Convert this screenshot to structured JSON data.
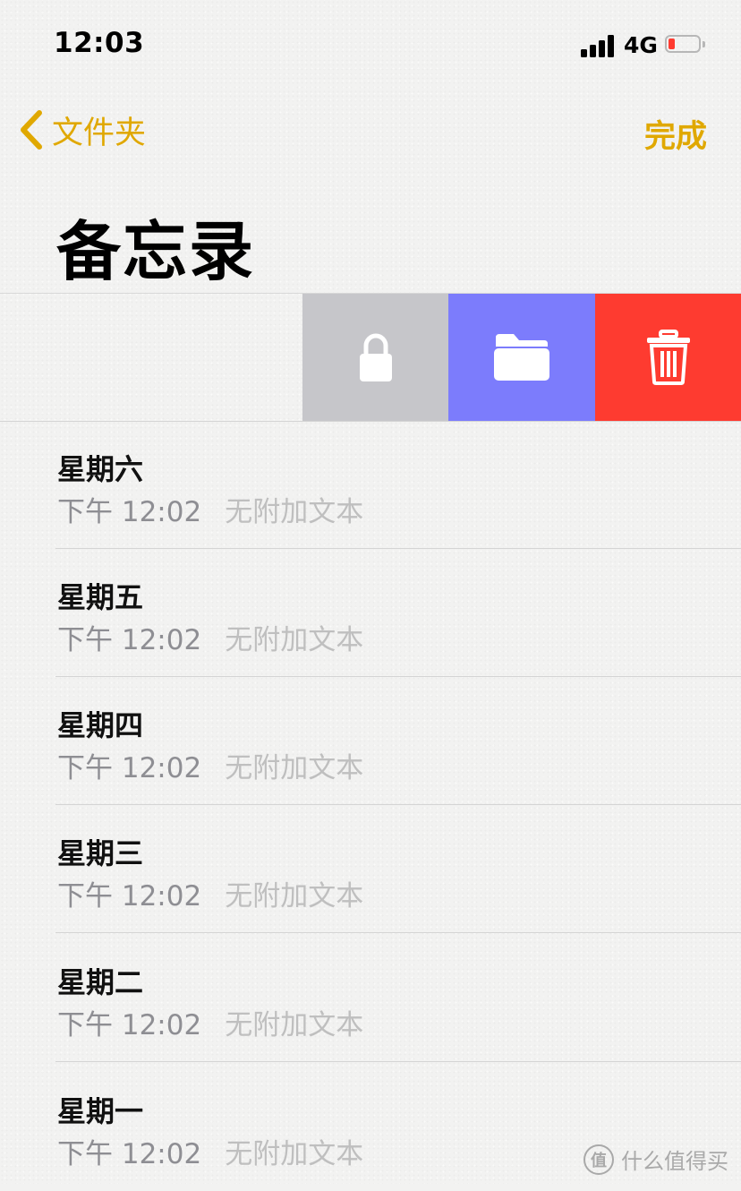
{
  "status_bar": {
    "time": "12:03",
    "network": "4G",
    "battery_level": 0.1
  },
  "nav": {
    "back_label": "文件夹",
    "done_label": "完成"
  },
  "page": {
    "title": "备忘录"
  },
  "swipe_actions": [
    {
      "icon": "lock-icon",
      "color": "#c6c6ca"
    },
    {
      "icon": "folder-icon",
      "color": "#7c7cfc"
    },
    {
      "icon": "trash-icon",
      "color": "#fe3b30"
    }
  ],
  "notes": [
    {
      "title": "星期六",
      "time": "下午 12:02",
      "preview": "无附加文本"
    },
    {
      "title": "星期五",
      "time": "下午 12:02",
      "preview": "无附加文本"
    },
    {
      "title": "星期四",
      "time": "下午 12:02",
      "preview": "无附加文本"
    },
    {
      "title": "星期三",
      "time": "下午 12:02",
      "preview": "无附加文本"
    },
    {
      "title": "星期二",
      "time": "下午 12:02",
      "preview": "无附加文本"
    },
    {
      "title": "星期一",
      "time": "下午 12:02",
      "preview": "无附加文本"
    }
  ],
  "watermark": {
    "logo_text": "值",
    "text": "什么值得买"
  },
  "accent_color": "#e0a800"
}
